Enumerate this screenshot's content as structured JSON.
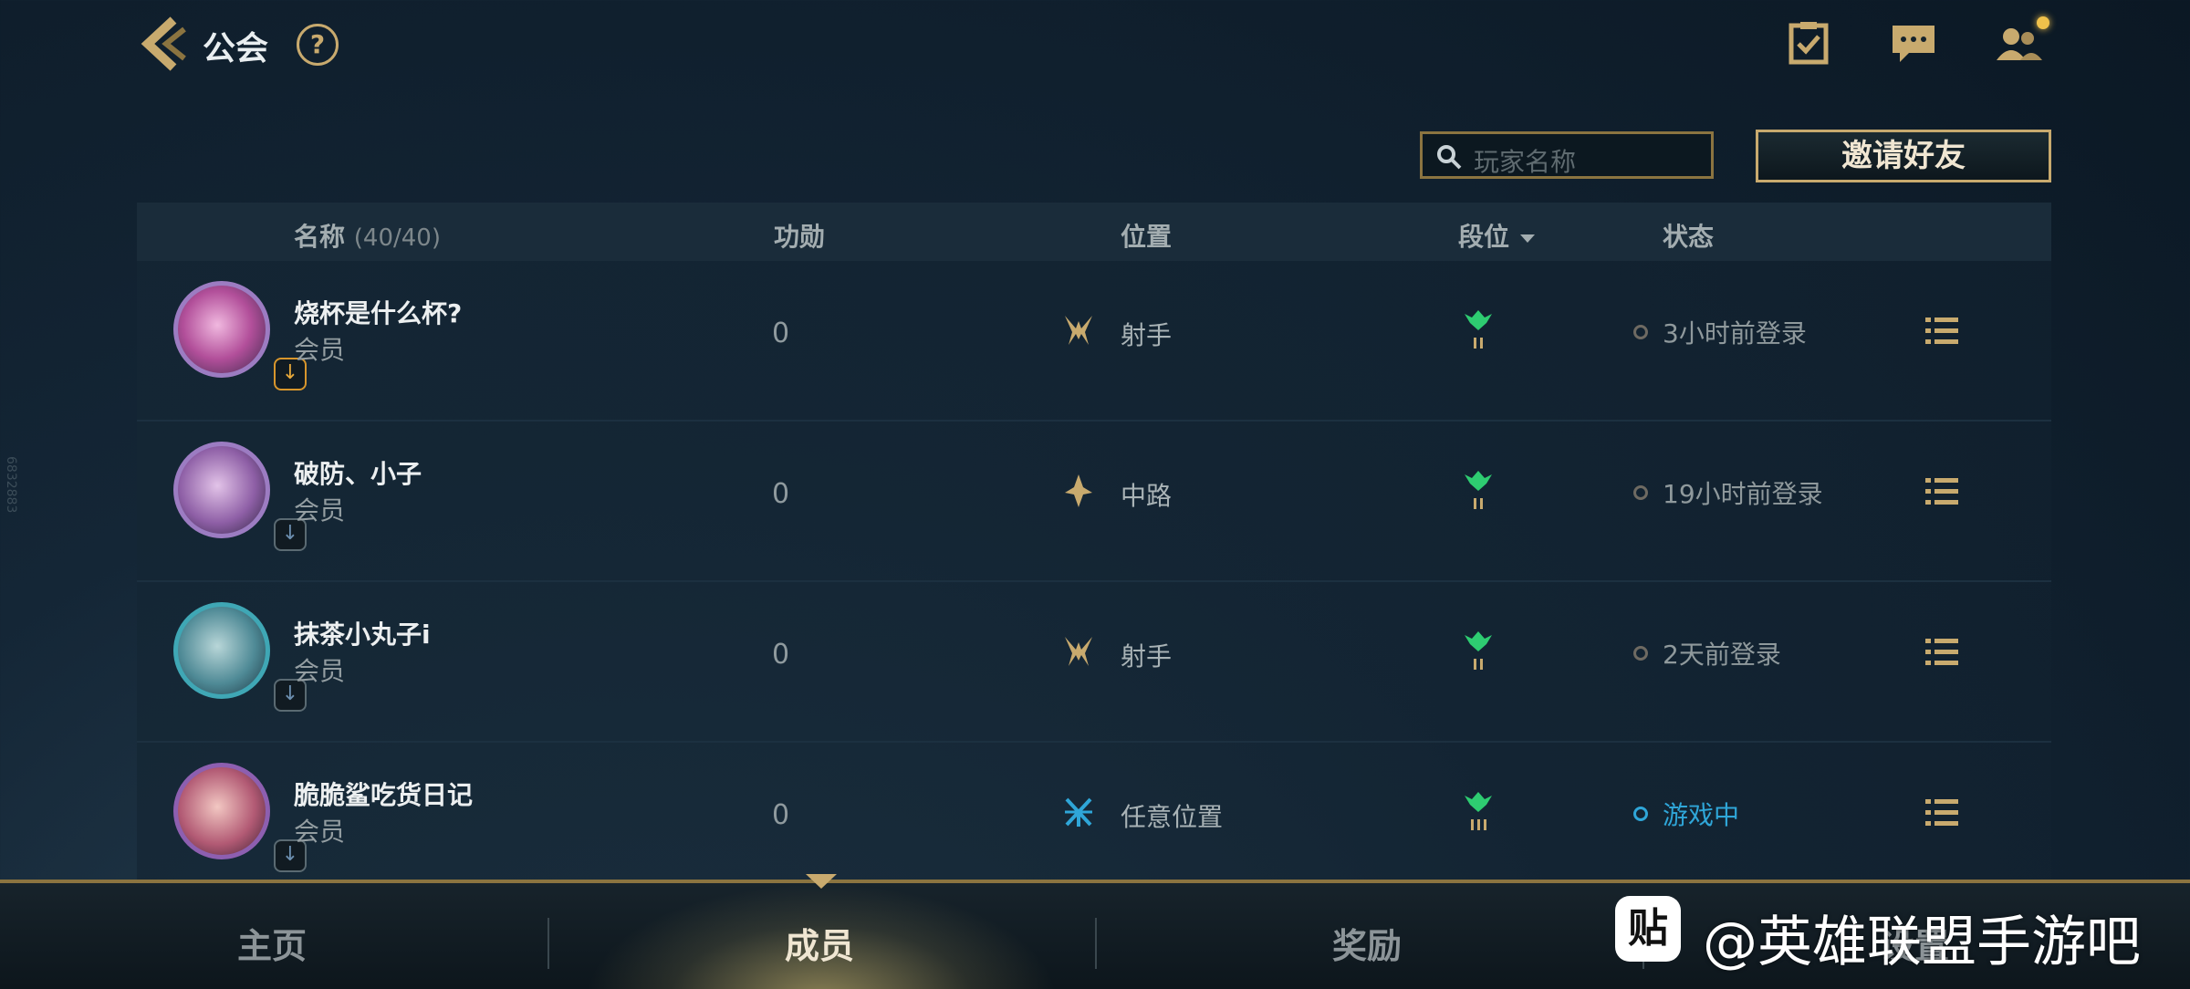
{
  "header": {
    "title": "公会",
    "help": "?"
  },
  "search": {
    "placeholder": "玩家名称"
  },
  "invite_button": "邀请好友",
  "table": {
    "columns": {
      "name": "名称",
      "count": "(40/40)",
      "merit": "功勋",
      "position": "位置",
      "rank": "段位",
      "status": "状态"
    },
    "rows": [
      {
        "name": "烧杯是什么杯?",
        "role": "会员",
        "merit": "0",
        "position": "射手",
        "status": "3小时前登录",
        "online": false
      },
      {
        "name": "破防、小子",
        "role": "会员",
        "merit": "0",
        "position": "中路",
        "status": "19小时前登录",
        "online": false
      },
      {
        "name": "抹茶小丸子i",
        "role": "会员",
        "merit": "0",
        "position": "射手",
        "status": "2天前登录",
        "online": false
      },
      {
        "name": "脆脆鲨吃货日记",
        "role": "会员",
        "merit": "0",
        "position": "任意位置",
        "status": "游戏中",
        "online": true
      }
    ]
  },
  "tabs": [
    "主页",
    "成员",
    "奖励",
    "设置"
  ],
  "active_tab": "成员",
  "watermark": {
    "logo": "贴",
    "text": "@英雄联盟手游吧"
  },
  "side_code": "6832883",
  "colors": {
    "gold": "#c8aa6e",
    "online": "#2fa6d8",
    "rank_green": "#2ecc71"
  }
}
